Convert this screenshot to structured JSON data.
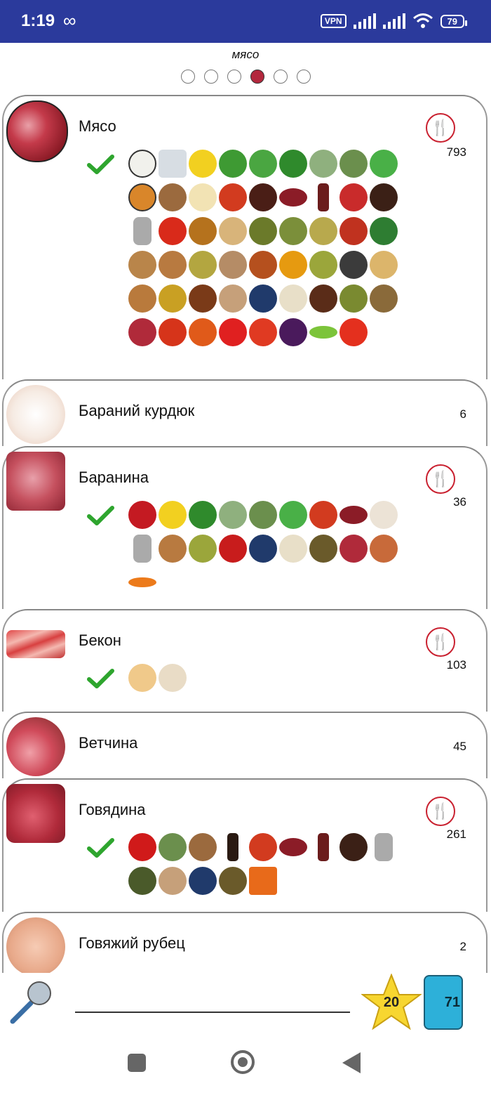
{
  "status_bar": {
    "time": "1:19",
    "vpn": "VPN",
    "battery": "79"
  },
  "category_title": "мясо",
  "carousel": {
    "pages": 6,
    "active": 4
  },
  "items": [
    {
      "name": "Мясо",
      "count": "793"
    },
    {
      "name": "Бараний курдюк",
      "count": "6"
    },
    {
      "name": "Баранина",
      "count": "36"
    },
    {
      "name": "Бекон",
      "count": "103"
    },
    {
      "name": "Ветчина",
      "count": "45"
    },
    {
      "name": "Говядина",
      "count": "261"
    },
    {
      "name": "Говяжий рубец",
      "count": "2"
    }
  ],
  "bottom": {
    "star_count": "20",
    "fridge_count": "71"
  },
  "colors": {
    "status_bar": "#2b3a9c",
    "accent_red": "#c9202f",
    "check_green": "#2ea52e"
  }
}
